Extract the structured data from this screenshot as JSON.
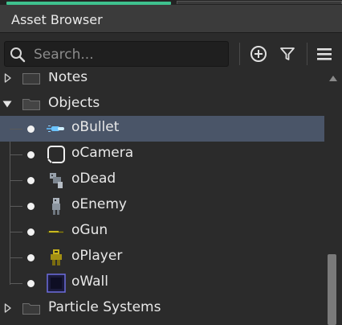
{
  "panel": {
    "title": "Asset Browser"
  },
  "search": {
    "placeholder": "Search..."
  },
  "toolbar": {
    "icons": [
      "plus-circle-icon",
      "filter-icon",
      "hamburger-menu-icon"
    ]
  },
  "tree": {
    "folders": [
      {
        "label": "Notes",
        "expanded": false
      },
      {
        "label": "Objects",
        "expanded": true
      },
      {
        "label": "Particle Systems",
        "expanded": false
      }
    ],
    "objects": [
      {
        "label": "oBullet",
        "icon": "bullet-sprite-icon",
        "selected": true
      },
      {
        "label": "oCamera",
        "icon": "camera-sprite-icon",
        "selected": false
      },
      {
        "label": "oDead",
        "icon": "dead-sprite-icon",
        "selected": false
      },
      {
        "label": "oEnemy",
        "icon": "enemy-sprite-icon",
        "selected": false
      },
      {
        "label": "oGun",
        "icon": "gun-sprite-icon",
        "selected": false
      },
      {
        "label": "oPlayer",
        "icon": "player-sprite-icon",
        "selected": false
      },
      {
        "label": "oWall",
        "icon": "wall-sprite-icon",
        "selected": false
      }
    ]
  },
  "colors": {
    "selection": "#4a5568",
    "accent": "#3ec18e",
    "background": "#2b2b2b"
  }
}
